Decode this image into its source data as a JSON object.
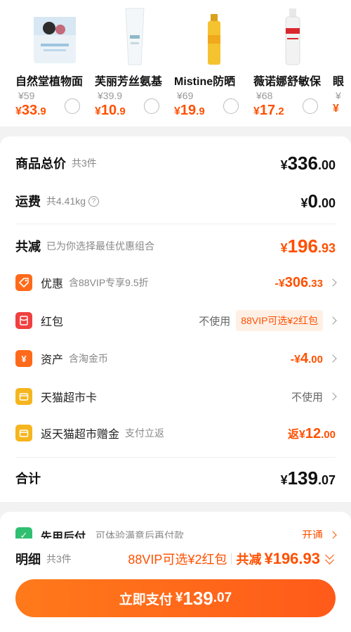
{
  "products": [
    {
      "name": "自然堂植物面",
      "orig_price": "¥59",
      "price_int": "33",
      "price_dec": ".9"
    },
    {
      "name": "芙丽芳丝氨基",
      "orig_price": "¥39.9",
      "price_int": "10",
      "price_dec": ".9"
    },
    {
      "name": "Mistine防晒",
      "orig_price": "¥69",
      "price_int": "19",
      "price_dec": ".9"
    },
    {
      "name": "薇诺娜舒敏保",
      "orig_price": "¥68",
      "price_int": "17",
      "price_dec": ".2"
    },
    {
      "name": "眼",
      "orig_price": "¥",
      "price_int": "",
      "price_dec": ""
    }
  ],
  "currency": "¥",
  "summary": {
    "goods_total_label": "商品总价",
    "goods_total_sub": "共3件",
    "goods_total_int": "336",
    "goods_total_dec": ".00",
    "shipping_label": "运费",
    "shipping_sub": "共4.41kg",
    "shipping_int": "0",
    "shipping_dec": ".00",
    "discount_label": "共减",
    "discount_sub": "已为你选择最佳优惠组合",
    "discount_int": "196",
    "discount_dec": ".93",
    "total_label": "合计",
    "total_int": "139",
    "total_dec": ".07"
  },
  "discount_items": [
    {
      "icon": "tag-icon",
      "title": "优惠",
      "desc": "含88VIP专享9.5折",
      "prefix": "-¥",
      "int": "306",
      "dec": ".33"
    },
    {
      "icon": "red-packet-icon",
      "title": "红包",
      "status": "不使用",
      "tag": "88VIP可选¥2红包"
    },
    {
      "icon": "yen-icon",
      "title": "资产",
      "desc": "含淘金币",
      "prefix": "-¥",
      "int": "4",
      "dec": ".00"
    },
    {
      "icon": "card-icon",
      "title": "天猫超市卡",
      "status": "不使用"
    },
    {
      "icon": "gift-card-icon",
      "title": "返天猫超市赠金",
      "desc": "支付立返",
      "prefix": "返¥",
      "int": "12",
      "dec": ".00"
    }
  ],
  "pay_later": {
    "title": "先用后付",
    "desc": "可体验满意后再付款",
    "action": "开通"
  },
  "bottom_bar": {
    "detail_label": "明细",
    "detail_sub": "共3件",
    "vip_text": "88VIP可选¥2红包",
    "reduce_label": "共减",
    "reduce_amount": "¥196.93",
    "pay_label": "立即支付",
    "pay_int": "139",
    "pay_dec": ".07"
  },
  "colors": {
    "accent": "#ff5000",
    "tag_bg": "#fff0e6"
  }
}
